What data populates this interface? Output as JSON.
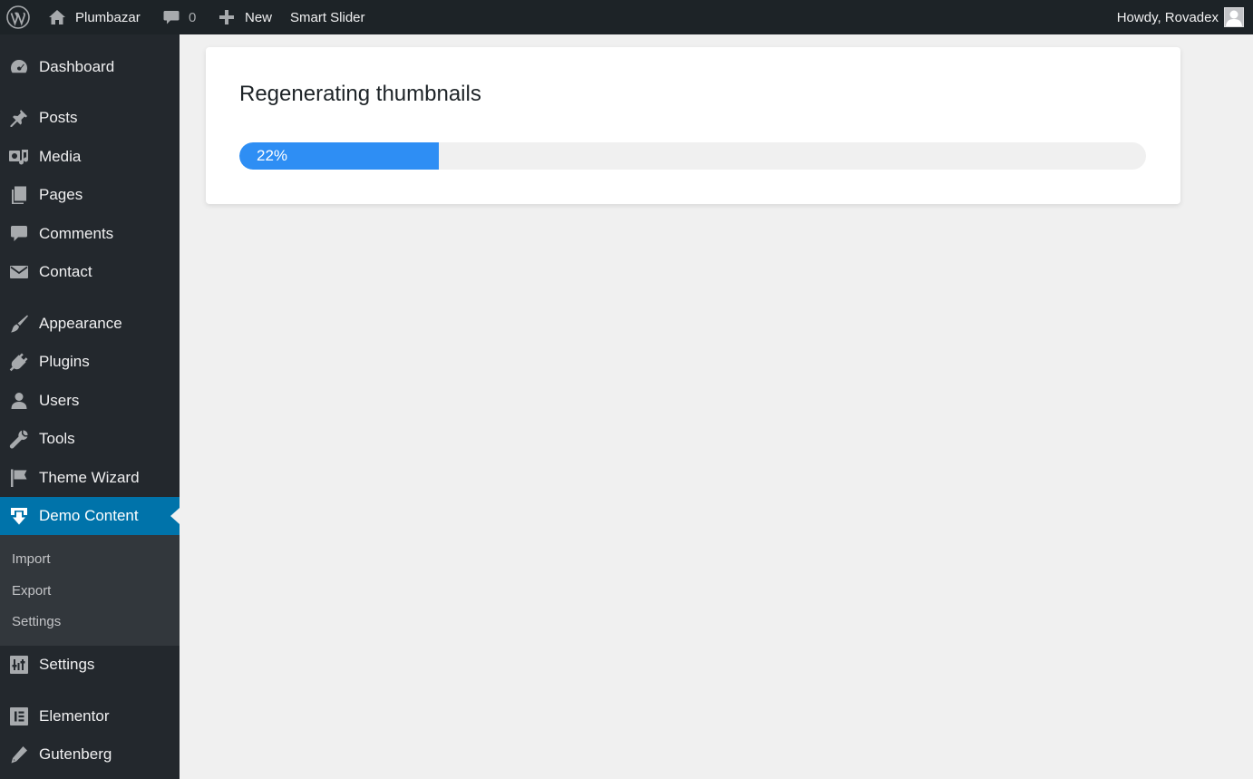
{
  "adminbar": {
    "site_name": "Plumbazar",
    "comments_count": "0",
    "new_label": "New",
    "smart_slider_label": "Smart Slider",
    "howdy_text": "Howdy, Rovadex",
    "icons": [
      "wordpress-logo-icon",
      "home-icon",
      "comment-bubble-icon",
      "plus-icon",
      "avatar-icon"
    ]
  },
  "sidebar": {
    "items": [
      {
        "label": "Dashboard",
        "icon": "dashboard-icon"
      },
      {
        "label": "Posts",
        "icon": "pin-icon"
      },
      {
        "label": "Media",
        "icon": "media-icon"
      },
      {
        "label": "Pages",
        "icon": "pages-icon"
      },
      {
        "label": "Comments",
        "icon": "comment-icon"
      },
      {
        "label": "Contact",
        "icon": "envelope-icon"
      },
      {
        "label": "Appearance",
        "icon": "brush-icon"
      },
      {
        "label": "Plugins",
        "icon": "plug-icon"
      },
      {
        "label": "Users",
        "icon": "user-icon"
      },
      {
        "label": "Tools",
        "icon": "wrench-icon"
      },
      {
        "label": "Theme Wizard",
        "icon": "flag-icon"
      },
      {
        "label": "Demo Content",
        "icon": "download-icon",
        "current": true
      },
      {
        "label": "Settings",
        "icon": "sliders-icon"
      },
      {
        "label": "Elementor",
        "icon": "elementor-icon"
      },
      {
        "label": "Gutenberg",
        "icon": "pencil-icon"
      }
    ],
    "submenu": [
      {
        "label": "Import"
      },
      {
        "label": "Export"
      },
      {
        "label": "Settings"
      }
    ]
  },
  "main": {
    "title": "Regenerating thumbnails",
    "progress": {
      "label": "22%",
      "value": 0.22
    }
  },
  "colors": {
    "adminbar_bg": "#1d2327",
    "sidebar_bg": "#23282d",
    "submenu_bg": "#32373c",
    "current_item_bg": "#0073aa",
    "progress_fill": "#2e8ef4",
    "page_bg": "#f0f0f0"
  }
}
